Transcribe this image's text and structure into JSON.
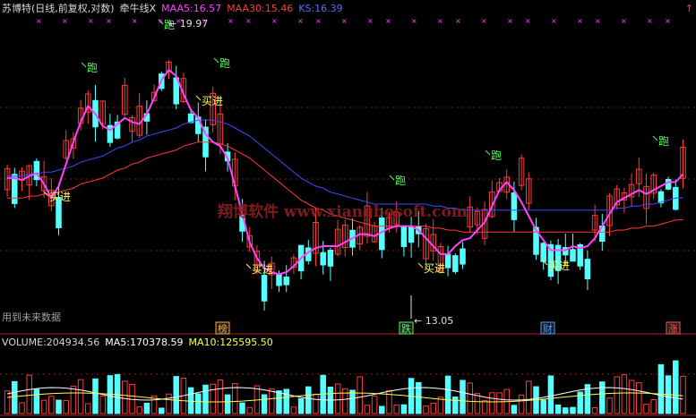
{
  "header": {
    "title": "苏博特(日线,前复权,对数)",
    "indicator": "牵牛线X",
    "maa5_label": "MAA5:",
    "maa5_value": "16.57",
    "maa30_label": "MAA30:",
    "maa30_value": "15.46",
    "ks_label": "KS:",
    "ks_value": "16.39",
    "corner_glyph": "↑"
  },
  "volume_header": {
    "volume_label": "VOLUME:",
    "volume_value": "204934.56",
    "ma5_label": "MA5:",
    "ma5_value": "170378.59",
    "ma10_label": "MA10:",
    "ma10_value": "125595.50"
  },
  "notes": {
    "future_data": "用到未来数据",
    "watermark": "翔博软件 www.xiangbosoft.com"
  },
  "colors": {
    "up": "#ff3b3b",
    "down": "#55ffff",
    "maa5": "#ff44ff",
    "maa30": "#ff3b3b",
    "ks": "#3a4cff",
    "buy": "#ffff55",
    "run": "#55ff55",
    "vol_ma5": "#ffffff",
    "vol_ma10": "#ffff55"
  },
  "chart_data": {
    "type": "candlestick",
    "title": "苏博特(日线,前复权,对数)",
    "price_range": [
      12.9,
      20.5
    ],
    "annotated_prices": {
      "high": 19.97,
      "low": 13.05
    },
    "series": [
      {
        "name": "MAA5",
        "values": [
          16.5,
          16.5,
          16.45,
          16.55,
          16.62,
          16.35,
          16.0,
          16.3,
          16.85,
          17.4,
          17.9,
          18.3,
          18.1,
          17.8,
          17.7,
          17.85,
          18.0,
          17.9,
          17.85,
          18.1,
          18.5,
          18.95,
          19.2,
          19.05,
          18.6,
          18.2,
          18.0,
          17.6,
          17.4,
          17.3,
          17.0,
          16.3,
          15.6,
          14.9,
          14.5,
          14.25,
          14.15,
          14.1,
          14.15,
          14.3,
          14.5,
          14.65,
          14.75,
          14.8,
          14.8,
          14.8,
          14.9,
          15.0,
          15.1,
          15.1,
          15.05,
          15.15,
          15.25,
          15.3,
          15.3,
          15.3,
          15.2,
          15.0,
          14.8,
          14.6,
          14.6,
          14.8,
          14.95,
          15.0,
          15.2,
          15.4,
          15.8,
          16.2,
          16.4,
          16.2,
          15.9,
          15.55,
          15.2,
          14.95,
          14.7,
          14.7,
          14.7,
          14.8,
          14.75,
          14.8,
          15.0,
          15.3,
          15.6,
          15.9,
          16.0,
          16.1,
          16.2,
          16.1,
          16.2,
          16.3,
          16.4,
          16.4,
          16.6
        ]
      },
      {
        "name": "MAA30",
        "values": [
          16.0,
          16.0,
          16.0,
          16.05,
          16.05,
          16.1,
          16.1,
          16.15,
          16.2,
          16.25,
          16.35,
          16.4,
          16.45,
          16.5,
          16.6,
          16.7,
          16.75,
          16.85,
          16.9,
          17.0,
          17.05,
          17.1,
          17.15,
          17.2,
          17.3,
          17.35,
          17.4,
          17.4,
          17.4,
          17.35,
          17.3,
          17.2,
          17.1,
          17.0,
          16.85,
          16.7,
          16.55,
          16.4,
          16.25,
          16.1,
          15.95,
          15.85,
          15.75,
          15.7,
          15.6,
          15.55,
          15.5,
          15.45,
          15.4,
          15.35,
          15.3,
          15.3,
          15.3,
          15.3,
          15.3,
          15.3,
          15.3,
          15.3,
          15.25,
          15.25,
          15.2,
          15.2,
          15.15,
          15.15,
          15.15,
          15.15,
          15.15,
          15.15,
          15.15,
          15.15,
          15.15,
          15.15,
          15.15,
          15.15,
          15.15,
          15.15,
          15.15,
          15.15,
          15.15,
          15.15,
          15.15,
          15.15,
          15.15,
          15.2,
          15.2,
          15.25,
          15.25,
          15.3,
          15.3,
          15.35,
          15.4,
          15.45,
          15.46
        ]
      }
    ],
    "markers": [
      {
        "label": "买进",
        "color": "buy"
      },
      {
        "label": "跑",
        "color": "run"
      },
      {
        "label": "跑",
        "color": "run"
      },
      {
        "label": "跑",
        "color": "run"
      },
      {
        "label": "买进",
        "color": "buy"
      },
      {
        "label": "买进",
        "color": "buy"
      },
      {
        "label": "跑",
        "color": "run"
      },
      {
        "label": "买进",
        "color": "buy"
      },
      {
        "label": "跑",
        "color": "run"
      },
      {
        "label": "买进",
        "color": "buy"
      },
      {
        "label": "跑",
        "color": "run"
      }
    ],
    "event_tags": [
      "榜",
      "跌",
      "财",
      "涨"
    ],
    "volume_series": [
      {
        "name": "VOLUME"
      },
      {
        "name": "MA5"
      },
      {
        "name": "MA10"
      }
    ]
  }
}
